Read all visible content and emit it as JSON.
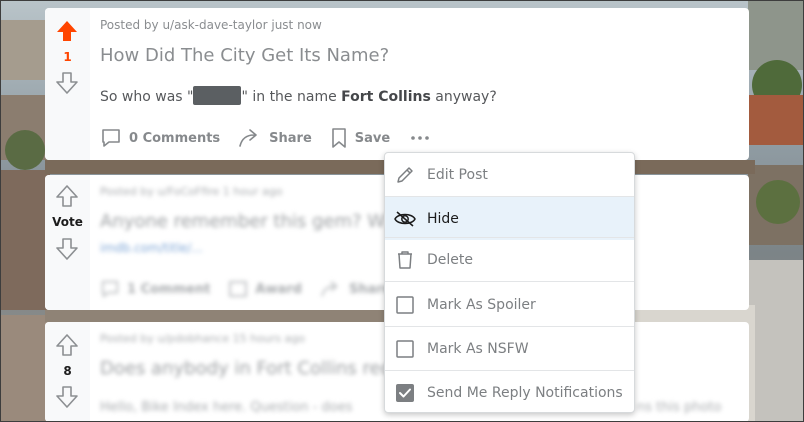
{
  "post1": {
    "vote_count": "1",
    "meta": "Posted by u/ask-dave-taylor just now",
    "title": "How Did The City Get Its Name?",
    "body_prefix": "So who was \"",
    "body_mid": "\" in the name ",
    "body_bold": "Fort Collins",
    "body_suffix": " anyway?",
    "actions": {
      "comments": "0 Comments",
      "share": "Share",
      "save": "Save"
    }
  },
  "post2": {
    "vote_label": "Vote",
    "meta": "Posted by u/FoCoFfire 1 hour ago",
    "title": "Anyone remember this gem? W",
    "link": "imdb.com/title/...",
    "actions": {
      "comments": "1 Comment",
      "award": "Award",
      "share": "Share"
    }
  },
  "post3": {
    "vote_count": "8",
    "meta": "Posted by u/pdobhance 15 hours ago",
    "title": "Does anybody in Fort Collins rec",
    "body": "Hello, Bike Index here. Question - does",
    "body_tail": "ns this photo"
  },
  "menu": {
    "items": [
      {
        "label": "Edit Post",
        "icon": "pencil-icon"
      },
      {
        "label": "Hide",
        "icon": "eye-slash-icon"
      },
      {
        "label": "Delete",
        "icon": "trash-icon"
      },
      {
        "label": "Mark As Spoiler",
        "icon": "checkbox-empty-icon"
      },
      {
        "label": "Mark As NSFW",
        "icon": "checkbox-empty-icon"
      },
      {
        "label": "Send Me Reply Notifications",
        "icon": "checkbox-checked-icon"
      }
    ]
  },
  "colors": {
    "upvote_active": "#ff4500",
    "menu_hover": "#e8f2fa"
  }
}
